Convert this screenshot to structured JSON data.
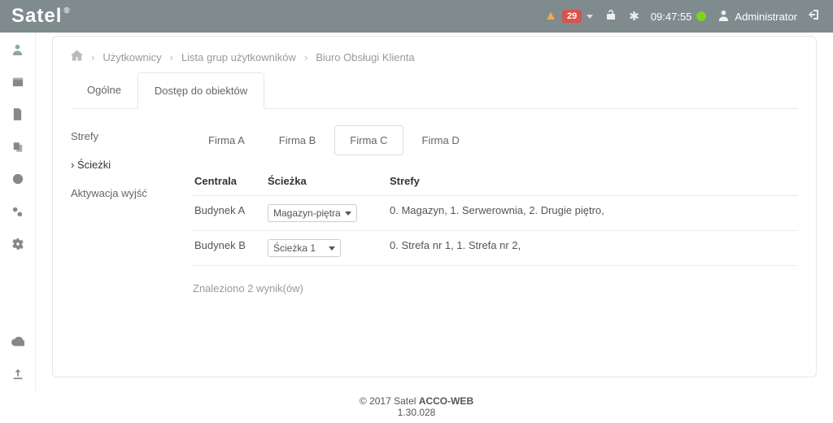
{
  "header": {
    "brand": "Satel",
    "alert_count": "29",
    "clock": "09:47:55",
    "user_label": "Administrator"
  },
  "breadcrumb": {
    "items": [
      "Użytkownicy",
      "Lista grup użytkowników",
      "Biuro Obsługi Klienta"
    ]
  },
  "tabs": {
    "general": "Ogólne",
    "access": "Dostęp do obiektów"
  },
  "subnav": {
    "zones": "Strefy",
    "paths": "Ścieżki",
    "outputs": "Aktywacja wyjść"
  },
  "firms": {
    "a": "Firma A",
    "b": "Firma B",
    "c": "Firma C",
    "d": "Firma D"
  },
  "table": {
    "headers": {
      "central": "Centrala",
      "path": "Ścieżka",
      "zones": "Strefy"
    },
    "rows": [
      {
        "central": "Budynek A",
        "path": "Magazyn-piętra",
        "zones": "0. Magazyn, 1. Serwerownia, 2. Drugie piętro,"
      },
      {
        "central": "Budynek B",
        "path": "Ścieżka 1",
        "zones": "0. Strefa nr 1, 1. Strefa nr 2,"
      }
    ],
    "results": "Znaleziono 2 wynik(ów)"
  },
  "footer": {
    "copyright": "© 2017 Satel ",
    "product": "ACCO-WEB",
    "version": "1.30.028"
  }
}
